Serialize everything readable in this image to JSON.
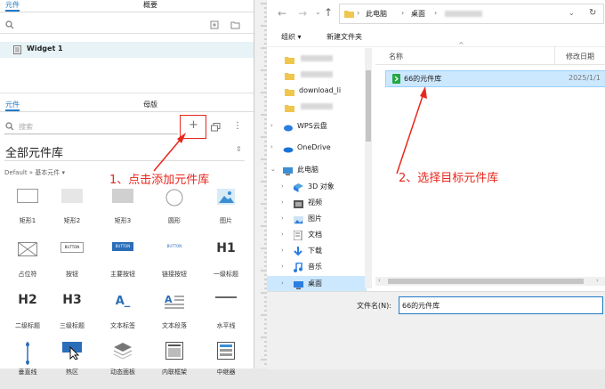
{
  "left": {
    "top_tabs": [
      "元件",
      "概要"
    ],
    "widget1": "Widget 1",
    "lib_tabs": [
      "元件",
      "母版"
    ],
    "search_placeholder": "搜索",
    "library_title": "全部元件库",
    "breadcrumb": "Default » 基本元件 ▾",
    "widgets": [
      {
        "label": "矩形1",
        "icon": "rect-outline-icon"
      },
      {
        "label": "矩形2",
        "icon": "rect-gray-icon"
      },
      {
        "label": "矩形3",
        "icon": "rect-dark-icon"
      },
      {
        "label": "圆形",
        "icon": "circle-icon"
      },
      {
        "label": "图片",
        "icon": "image-icon"
      },
      {
        "label": "占位符",
        "icon": "placeholder-icon"
      },
      {
        "label": "按钮",
        "icon": "button-icon",
        "text": "BUTTON"
      },
      {
        "label": "主要按钮",
        "icon": "primary-button-icon",
        "text": "BUTTON"
      },
      {
        "label": "链接按钮",
        "icon": "link-button-icon",
        "text": "BUTTON"
      },
      {
        "label": "一级标题",
        "icon": "h1-icon",
        "text": "H1"
      },
      {
        "label": "二级标题",
        "icon": "h2-icon",
        "text": "H2"
      },
      {
        "label": "三级标题",
        "icon": "h3-icon",
        "text": "H3"
      },
      {
        "label": "文本标签",
        "icon": "text-label-icon",
        "text": "A_"
      },
      {
        "label": "文本段落",
        "icon": "paragraph-icon",
        "text": "A"
      },
      {
        "label": "水平线",
        "icon": "hline-icon"
      },
      {
        "label": "垂直线",
        "icon": "vline-icon"
      },
      {
        "label": "热区",
        "icon": "hotspot-icon"
      },
      {
        "label": "动态面板",
        "icon": "dynamic-panel-icon"
      },
      {
        "label": "内联框架",
        "icon": "inline-frame-icon"
      },
      {
        "label": "中继器",
        "icon": "repeater-icon"
      }
    ]
  },
  "annotations": {
    "step1": "1、点击添加元件库",
    "step2": "2、选择目标元件库"
  },
  "explorer": {
    "address": [
      "此电脑",
      "桌面"
    ],
    "toolbar": {
      "organize": "组织 ▾",
      "new_folder": "新建文件夹"
    },
    "nav_folders": [
      "",
      "",
      "download_li",
      ""
    ],
    "nav_items": [
      {
        "label": "WPS云盘",
        "icon": "wps-cloud-icon",
        "chev": "›"
      },
      {
        "label": "OneDrive",
        "icon": "onedrive-icon",
        "chev": "›"
      },
      {
        "label": "此电脑",
        "icon": "computer-icon",
        "chev": "⌄"
      },
      {
        "label": "3D 对象",
        "icon": "3d-objects-icon",
        "chev": "›"
      },
      {
        "label": "视频",
        "icon": "videos-icon",
        "chev": "›"
      },
      {
        "label": "图片",
        "icon": "pictures-icon",
        "chev": "›"
      },
      {
        "label": "文档",
        "icon": "documents-icon",
        "chev": "›"
      },
      {
        "label": "下载",
        "icon": "downloads-icon",
        "chev": "›"
      },
      {
        "label": "音乐",
        "icon": "music-icon",
        "chev": "›"
      },
      {
        "label": "桌面",
        "icon": "desktop-icon",
        "chev": "›"
      }
    ],
    "columns": {
      "name": "名称",
      "modified": "修改日期"
    },
    "file": {
      "name": "66的元件库",
      "date": "2025/1/1"
    },
    "filename_label": "文件名(N):",
    "filename_value": "66的元件库"
  },
  "colors": {
    "accent": "#1f7ac7",
    "annotation": "#e8271d",
    "selection": "#cce8ff"
  }
}
